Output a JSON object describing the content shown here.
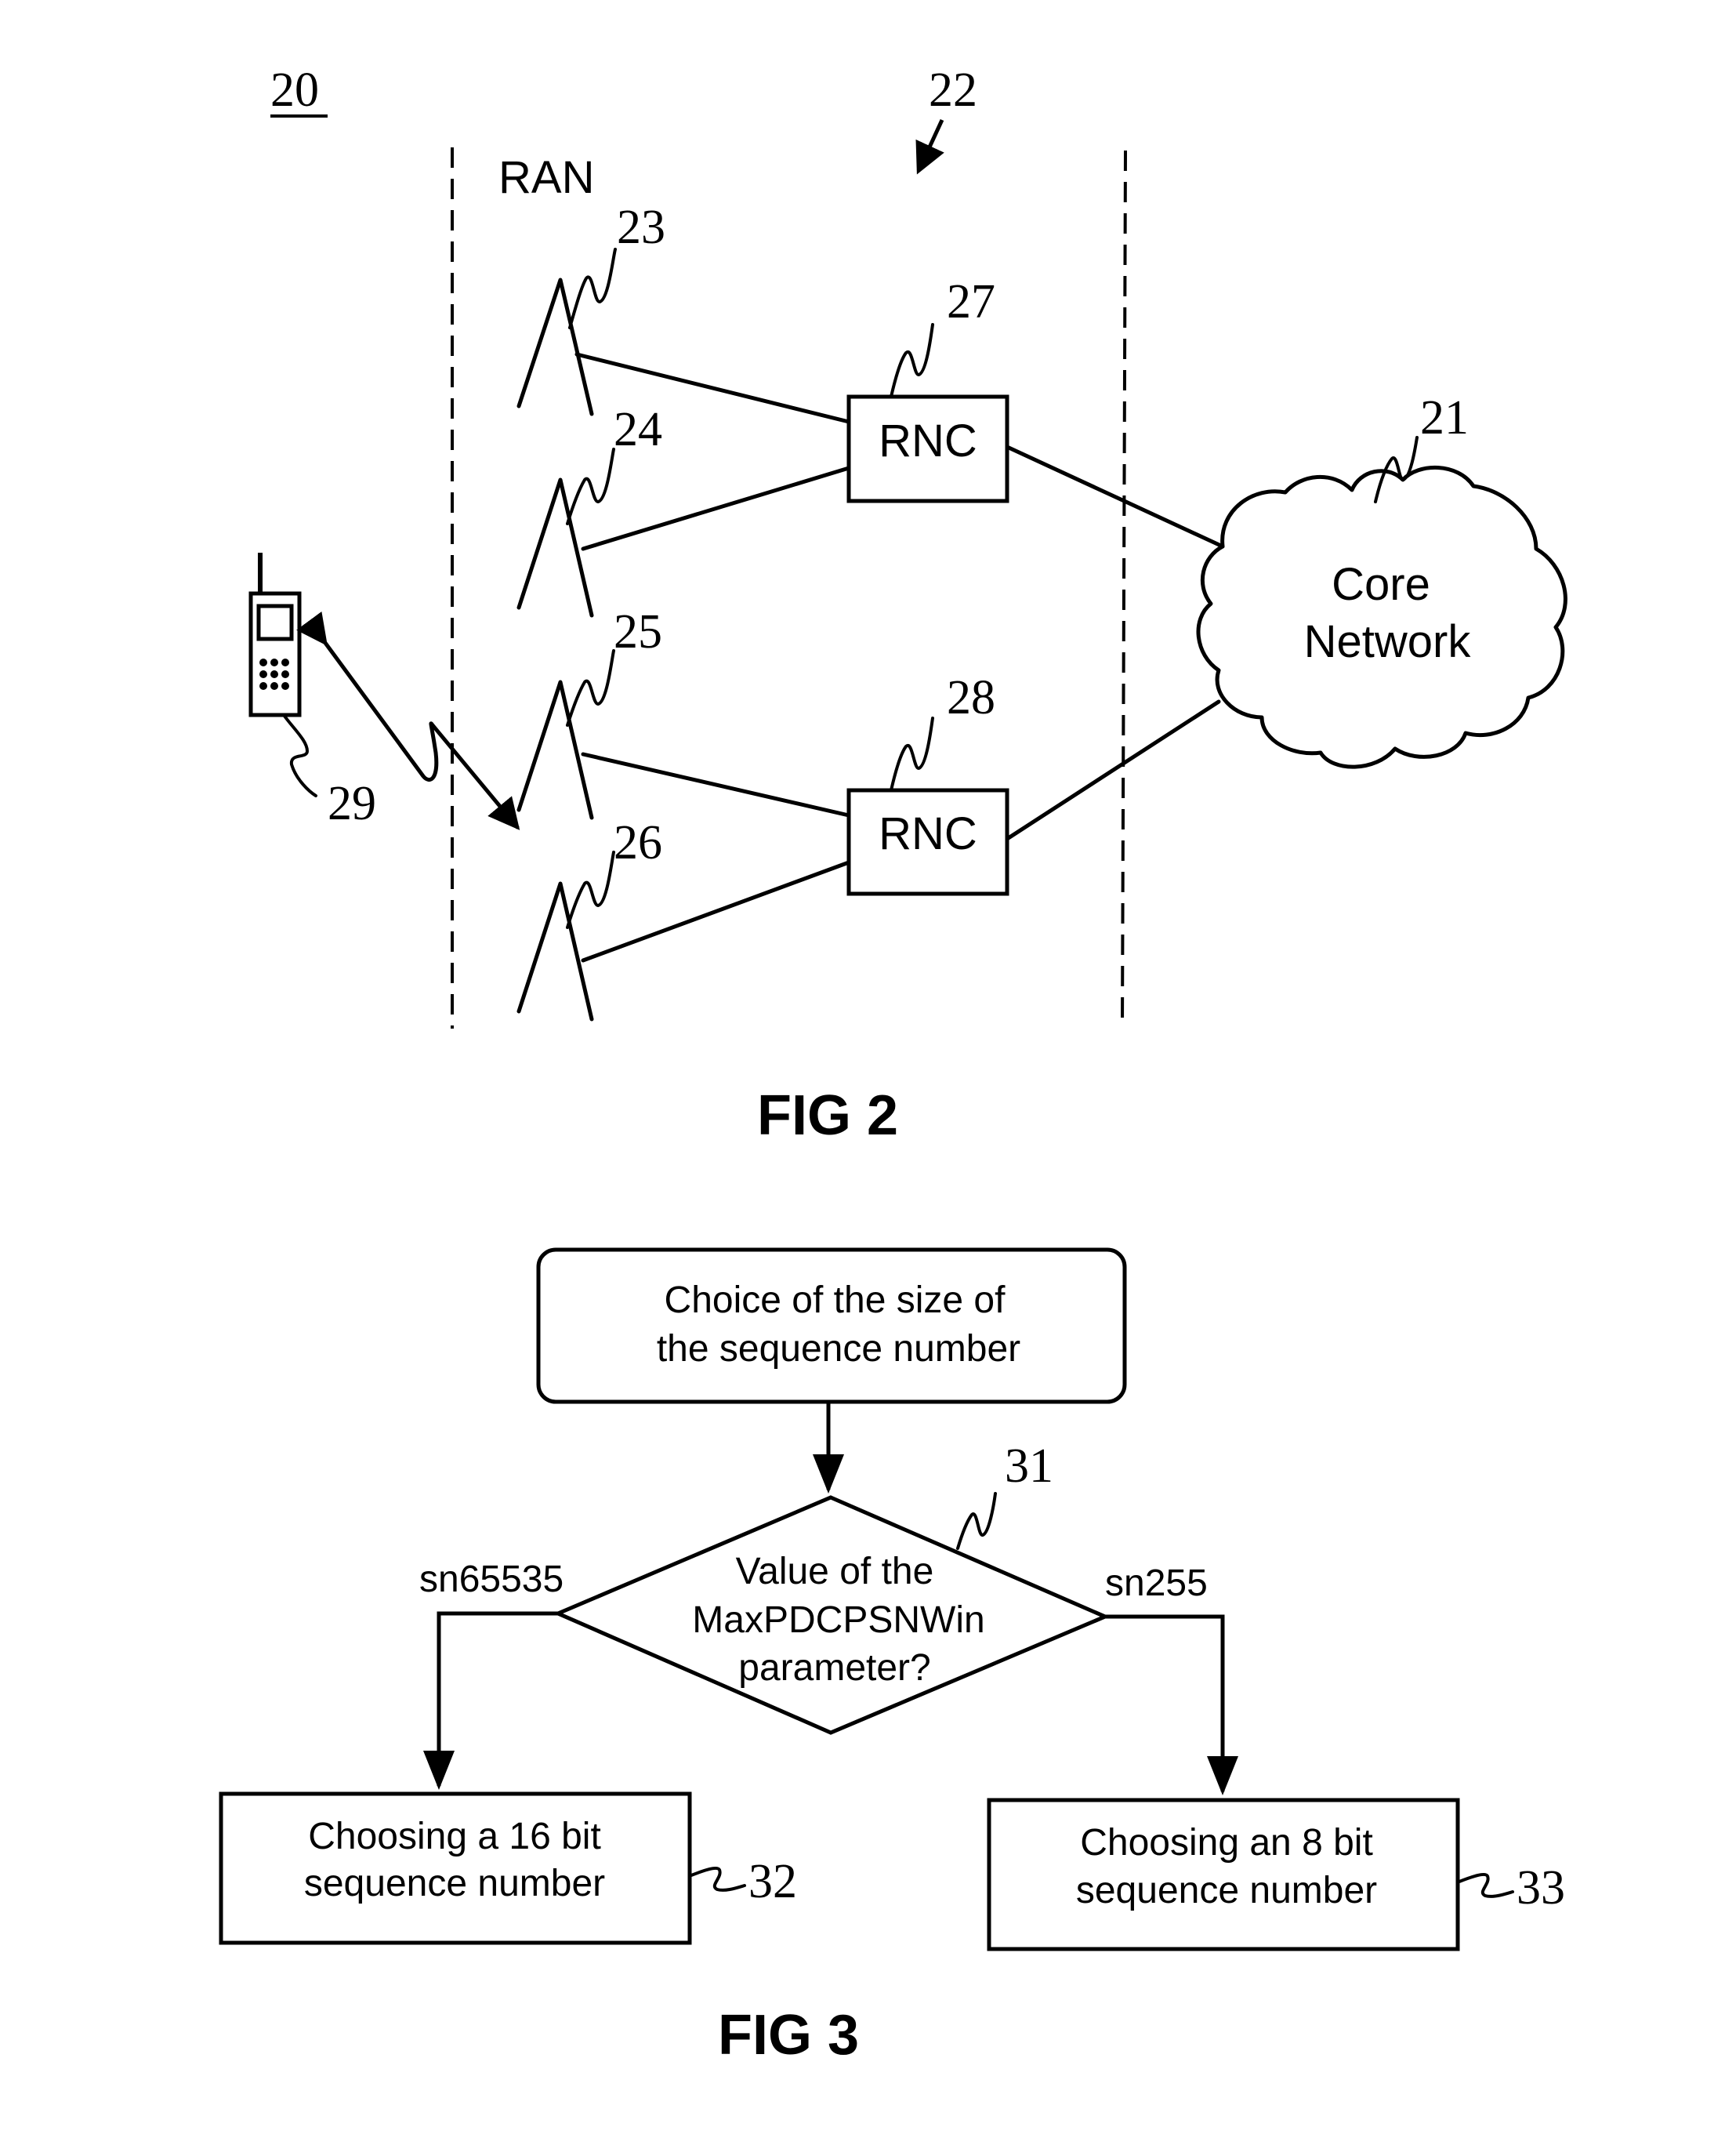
{
  "fig2": {
    "title": "FIG 2",
    "system_ref": "20",
    "ran_label": "RAN",
    "ran_ref": "22",
    "core_network": {
      "ref": "21",
      "line1": "Core",
      "line2": "Network"
    },
    "base_stations": [
      {
        "ref": "23"
      },
      {
        "ref": "24"
      },
      {
        "ref": "25"
      },
      {
        "ref": "26"
      }
    ],
    "rncs": [
      {
        "ref": "27",
        "label": "RNC"
      },
      {
        "ref": "28",
        "label": "RNC"
      }
    ],
    "mobile": {
      "ref": "29"
    }
  },
  "fig3": {
    "title": "FIG 3",
    "start": {
      "line1": "Choice of the size of",
      "line2": "the sequence number"
    },
    "decision": {
      "ref": "31",
      "line1": "Value of the",
      "line2": "MaxPDCPSNWin",
      "line3": "parameter?"
    },
    "branch_left": "sn65535",
    "branch_right": "sn255",
    "box_left": {
      "ref": "32",
      "line1": "Choosing a 16 bit",
      "line2": "sequence number"
    },
    "box_right": {
      "ref": "33",
      "line1": "Choosing an 8 bit",
      "line2": "sequence number"
    }
  }
}
